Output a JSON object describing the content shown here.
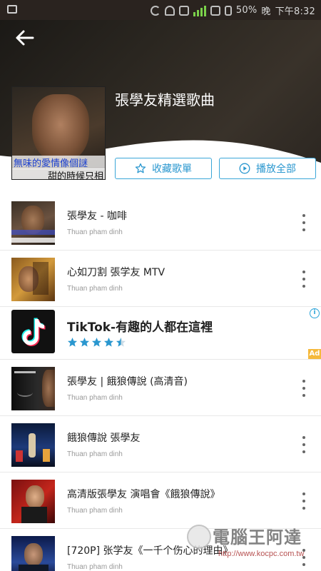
{
  "status_bar": {
    "battery": "50%",
    "time_text": "下午8:32",
    "extra_text": "晚"
  },
  "header": {
    "playlist_title": "張學友精選歌曲",
    "cover_caption_top": "無味的愛情像個謎",
    "cover_caption_bottom": "甜的時候只相",
    "collect_label": "收藏歌單",
    "play_all_label": "播放全部"
  },
  "songs_top": [
    {
      "title": "張學友 - 咖啡",
      "channel": "Thuan pham dinh"
    },
    {
      "title": "心如刀割   張学友  MTV",
      "channel": "Thuan pham dinh"
    }
  ],
  "ad": {
    "title": "TikTok-有趣的人都在這裡",
    "rating": 4.5,
    "info_icon": "i",
    "badge": "Ad"
  },
  "songs_bottom": [
    {
      "title": "張學友 | 餓狼傳說 (高清音)",
      "channel": "Thuan pham dinh"
    },
    {
      "title": "餓狼傳說 張學友",
      "channel": "Thuan pham dinh"
    },
    {
      "title": "高清版張學友 演唱會《餓狼傳說》",
      "channel": "Thuan pham dinh"
    },
    {
      "title": "[720P] 张学友《一千个伤心的理由》",
      "channel": "Thuan pham dinh"
    }
  ],
  "watermark": {
    "name": "電腦王阿達",
    "url": "http://www.kocpc.com.tw"
  },
  "colors": {
    "accent": "#2a97cf",
    "header_bg": "#2a2620",
    "ad_badge": "#f5b93c"
  },
  "icons": [
    "back-arrow-icon",
    "star-outline-icon",
    "play-circle-icon",
    "more-vert-icon",
    "tiktok-logo-icon",
    "info-icon",
    "star-icon"
  ]
}
